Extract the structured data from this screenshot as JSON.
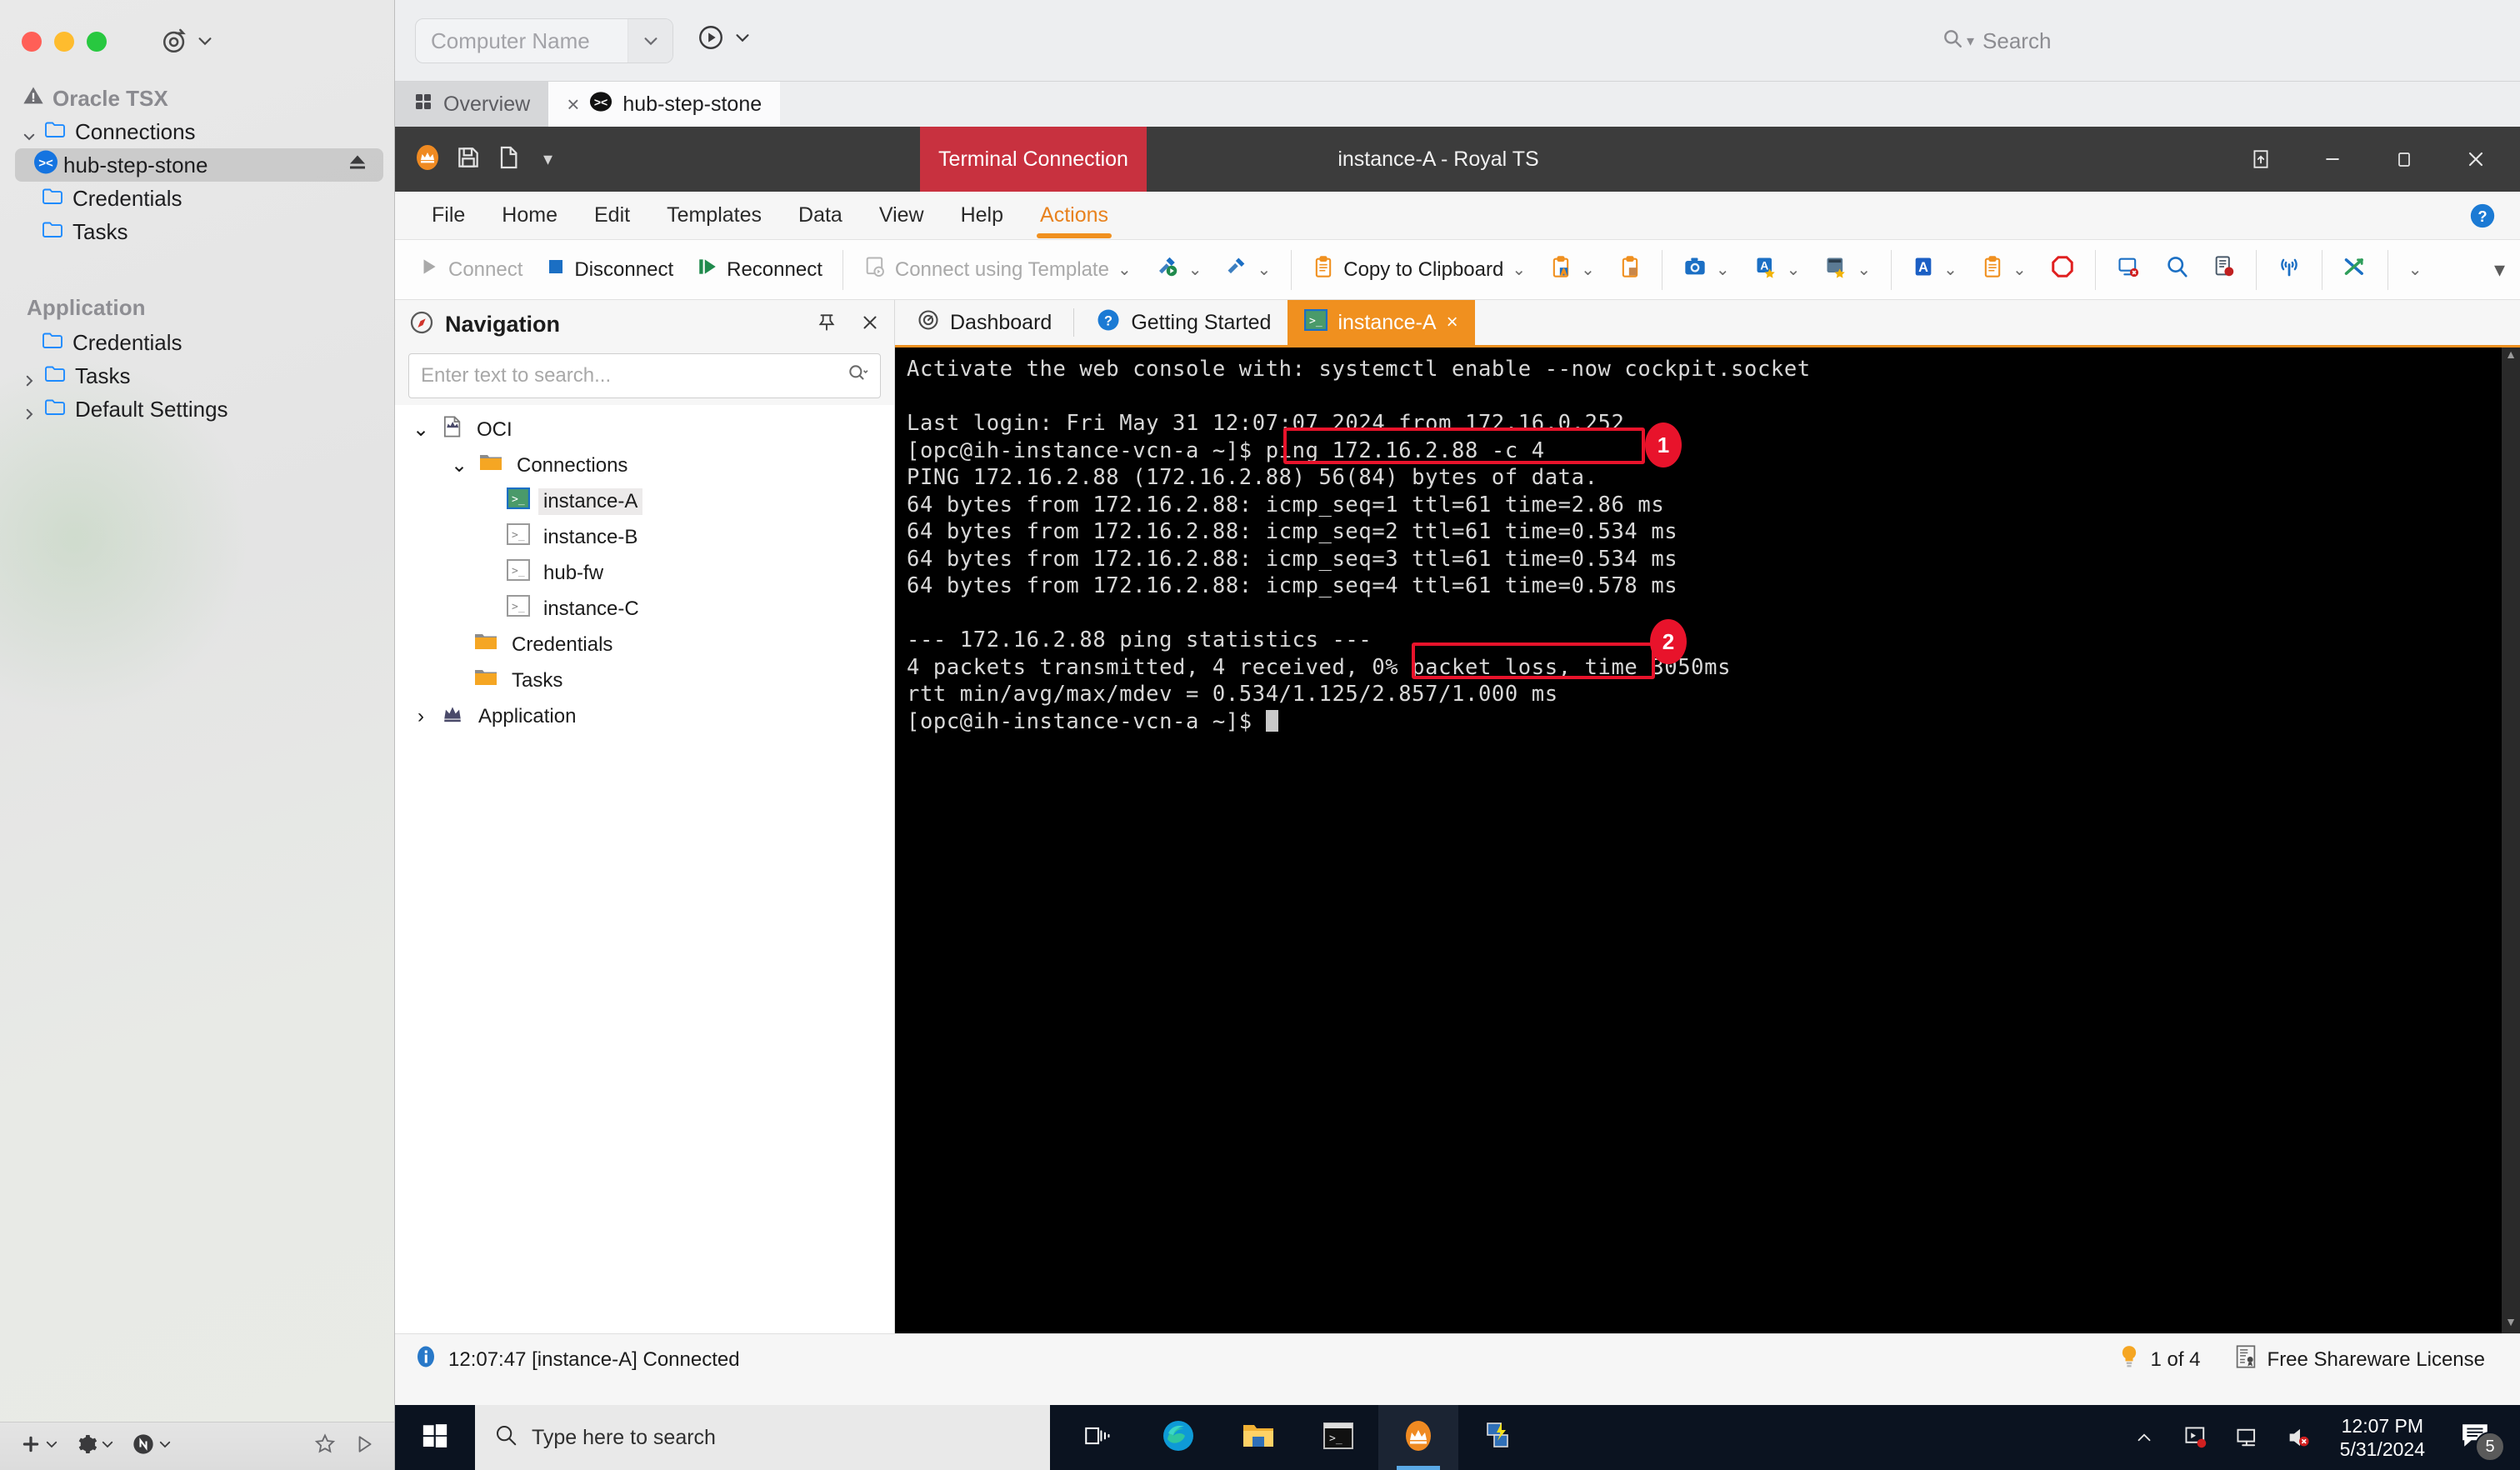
{
  "mac": {
    "toolbar": {
      "target_icon": "target-icon",
      "chevron": "chevron-down-icon"
    },
    "sidebar": {
      "root_label": "Oracle TSX",
      "items": [
        {
          "label": "Connections",
          "icon": "folder-icon",
          "chevron": "chevron-down",
          "indent": 0
        },
        {
          "label": "hub-step-stone",
          "icon": "ssh-icon",
          "indent": 1,
          "selected": true,
          "eject": "eject-icon"
        },
        {
          "label": "Credentials",
          "icon": "folder-icon",
          "indent": 1
        },
        {
          "label": "Tasks",
          "icon": "folder-icon",
          "indent": 1
        }
      ],
      "group2_title": "Application",
      "group2_items": [
        {
          "label": "Credentials",
          "icon": "folder-icon",
          "chevron": ""
        },
        {
          "label": "Tasks",
          "icon": "folder-icon",
          "chevron": "chevron-right"
        },
        {
          "label": "Default Settings",
          "icon": "folder-icon",
          "chevron": "chevron-right"
        }
      ]
    },
    "bottombar": {
      "add": "plus-icon",
      "settings": "gear-icon",
      "sync": "sync-icon",
      "favorite": "star-icon",
      "play": "play-icon"
    },
    "topbar": {
      "computer_name_placeholder": "Computer Name",
      "search_placeholder": "Search"
    },
    "tabs": [
      {
        "label": "Overview",
        "icon": "grid-icon",
        "active": false,
        "closable": false
      },
      {
        "label": "hub-step-stone",
        "icon": "ssh-black-icon",
        "active": true,
        "closable": true,
        "close": "×"
      }
    ]
  },
  "royalts": {
    "titlebar": {
      "badge": "Terminal Connection",
      "window_title": "instance-A - Royal TS",
      "quick_access": [
        "crown-icon",
        "save-icon",
        "new-document-icon",
        "customize-caret-icon"
      ],
      "buttons": [
        "restore-ribbon-icon",
        "minimize-icon",
        "maximize-icon",
        "close-icon"
      ]
    },
    "menu": {
      "items": [
        "File",
        "Home",
        "Edit",
        "Templates",
        "Data",
        "View",
        "Help",
        "Actions"
      ],
      "active": "Actions",
      "help_icon": "help-icon"
    },
    "ribbon": {
      "connect": {
        "label": "Connect",
        "icon": "play-gray-icon",
        "disabled": true
      },
      "disconnect": {
        "label": "Disconnect",
        "icon": "stop-blue-icon",
        "disabled": false
      },
      "reconnect": {
        "label": "Reconnect",
        "icon": "reconnect-green-icon",
        "disabled": false
      },
      "connect_template": {
        "label": "Connect using Template",
        "icon": "template-icon",
        "disabled": true,
        "caret": "⌄"
      },
      "run_tool": {
        "icon": "hammer-run-icon",
        "caret": "⌄"
      },
      "tools": {
        "icon": "hammer-icon",
        "caret": "⌄"
      },
      "copy_to_clipboard": {
        "label": "Copy to Clipboard",
        "icon": "clipboard-icon",
        "caret": "⌄"
      },
      "copy_text": {
        "icon": "clipboard-text-icon",
        "caret": "⌄"
      },
      "copy_image": {
        "icon": "clipboard-image-icon"
      },
      "screenshot": {
        "icon": "camera-icon",
        "caret": "⌄"
      },
      "favorite_a": {
        "icon": "letter-a-star-icon",
        "caret": "⌄"
      },
      "key_sequence": {
        "icon": "keyboard-star-icon",
        "caret": "⌄"
      },
      "font": {
        "icon": "letter-a-blue-icon",
        "caret": "⌄"
      },
      "paste": {
        "icon": "clipboard-orange-icon",
        "caret": "⌄"
      },
      "stop": {
        "icon": "stop-red-icon"
      },
      "close_session": {
        "icon": "monitor-close-icon"
      },
      "find": {
        "icon": "search-icon"
      },
      "log": {
        "icon": "log-record-icon"
      },
      "broadcast": {
        "icon": "broadcast-icon"
      },
      "shuffle": {
        "icon": "shuffle-icon"
      },
      "more": {
        "caret": "⌄"
      },
      "expand": {
        "caret": "∨"
      }
    },
    "navigation": {
      "title": "Navigation",
      "icon": "compass-icon",
      "pin_icon": "pin-icon",
      "close_icon": "close-icon",
      "search_placeholder": "Enter text to search...",
      "search_icon": "search-dropdown-icon",
      "tree": [
        {
          "label": "OCI",
          "icon": "crown-doc-icon",
          "indent": 0,
          "twisty": "⌄"
        },
        {
          "label": "Connections",
          "icon": "folder-orange-icon",
          "indent": 1,
          "twisty": "⌄"
        },
        {
          "label": "instance-A",
          "icon": "terminal-green-icon",
          "indent": 2,
          "twisty": "",
          "selected": true
        },
        {
          "label": "instance-B",
          "icon": "terminal-gray-icon",
          "indent": 2,
          "twisty": ""
        },
        {
          "label": "hub-fw",
          "icon": "terminal-gray-icon",
          "indent": 2,
          "twisty": ""
        },
        {
          "label": "instance-C",
          "icon": "terminal-gray-icon",
          "indent": 2,
          "twisty": ""
        },
        {
          "label": "Credentials",
          "icon": "folder-orange-icon",
          "indent": 1,
          "twisty": ""
        },
        {
          "label": "Tasks",
          "icon": "folder-orange-icon",
          "indent": 1,
          "twisty": ""
        },
        {
          "label": "Application",
          "icon": "crown-icon",
          "indent": 0,
          "twisty": "›"
        }
      ]
    },
    "session_tabs": [
      {
        "label": "Dashboard",
        "icon": "dashboard-icon",
        "selected": false,
        "closable": false
      },
      {
        "label": "Getting Started",
        "icon": "question-icon",
        "selected": false,
        "closable": false
      },
      {
        "label": "instance-A",
        "icon": "terminal-green-icon",
        "selected": true,
        "closable": true,
        "close": "×"
      }
    ],
    "terminal": {
      "lines": [
        "Activate the web console with: systemctl enable --now cockpit.socket",
        "",
        "Last login: Fri May 31 12:07:07 2024 from 172.16.0.252",
        "[opc@ih-instance-vcn-a ~]$ ping 172.16.2.88 -c 4",
        "PING 172.16.2.88 (172.16.2.88) 56(84) bytes of data.",
        "64 bytes from 172.16.2.88: icmp_seq=1 ttl=61 time=2.86 ms",
        "64 bytes from 172.16.2.88: icmp_seq=2 ttl=61 time=0.534 ms",
        "64 bytes from 172.16.2.88: icmp_seq=3 ttl=61 time=0.534 ms",
        "64 bytes from 172.16.2.88: icmp_seq=4 ttl=61 time=0.578 ms",
        "",
        "--- 172.16.2.88 ping statistics ---",
        "4 packets transmitted, 4 received, 0% packet loss, time 3050ms",
        "rtt min/avg/max/mdev = 0.534/1.125/2.857/1.000 ms",
        "[opc@ih-instance-vcn-a ~]$ "
      ],
      "prompt": "[opc@ih-instance-vcn-a ~]$"
    },
    "annotations": [
      {
        "number": "1",
        "target": "ping 172.16.2.88 -c 4",
        "color": "#e8132b"
      },
      {
        "number": "2",
        "target": "0% packet loss,",
        "color": "#e8132b"
      }
    ],
    "statusbar": {
      "info_icon": "info-icon",
      "message": "12:07:47 [instance-A] Connected",
      "tip_icon": "lightbulb-icon",
      "tip_count": "1 of 4",
      "license_icon": "license-icon",
      "license": "Free Shareware License"
    }
  },
  "windows_taskbar": {
    "start_icon": "windows-start-icon",
    "search_placeholder": "Type here to search",
    "search_icon": "search-icon",
    "taskview_icon": "task-view-icon",
    "pinned": [
      {
        "name": "edge-icon"
      },
      {
        "name": "file-explorer-icon"
      },
      {
        "name": "terminal-icon"
      },
      {
        "name": "royalts-icon",
        "active": true
      },
      {
        "name": "remote-tool-icon"
      }
    ],
    "tray": [
      "show-hidden-icons-chevron",
      "screen-record-icon",
      "network-icon",
      "volume-muted-icon"
    ],
    "clock_time": "12:07 PM",
    "clock_date": "5/31/2024",
    "notification_icon": "notification-icon",
    "notification_count": "5"
  },
  "colors": {
    "accent_orange": "#f0901f",
    "badge_red": "#c8313f",
    "annotation_red": "#e8132b",
    "terminal_bg": "#000000",
    "terminal_fg": "#d8d8d8",
    "titlebar": "#3c3c3c",
    "taskbar": "#0b1320"
  }
}
